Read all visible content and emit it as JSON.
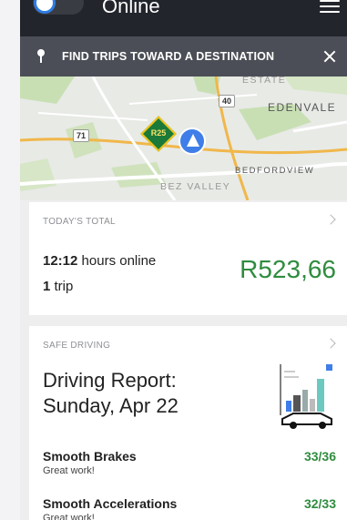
{
  "status": {
    "online_label": "Online"
  },
  "banner": {
    "text": "FIND TRIPS TOWARD A DESTINATION"
  },
  "map": {
    "labels": {
      "edenvale": "EDENVALE",
      "bedfordview": "BEDFORDVIEW",
      "bez_valley": "BEZ VALLEY",
      "estate": "ESTATE"
    },
    "shields": {
      "r40": "40",
      "r71": "71",
      "r25": "R25"
    }
  },
  "todays_total": {
    "header": "TODAY'S TOTAL",
    "hours_value": "12:12",
    "hours_suffix": "hours online",
    "trips_value": "1",
    "trips_suffix": "trip",
    "earnings": "R523,66"
  },
  "safe_driving": {
    "header": "SAFE DRIVING",
    "title_line1": "Driving Report:",
    "title_line2": "Sunday, Apr 22",
    "metrics": [
      {
        "name": "Smooth Brakes",
        "sub": "Great work!",
        "score": "33/36"
      },
      {
        "name": "Smooth Accelerations",
        "sub": "Great work!",
        "score": "32/33"
      }
    ]
  },
  "colors": {
    "accent_green": "#2f8c3f",
    "nav_blue": "#3f7ee8",
    "banner_bg": "#4b4e56",
    "topbar_bg": "#23252d"
  }
}
